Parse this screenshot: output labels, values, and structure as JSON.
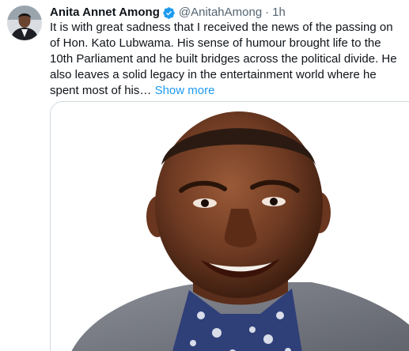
{
  "author": {
    "display_name": "Anita Annet Among",
    "handle": "@AnitahAmong",
    "separator": "·",
    "time": "1h",
    "verified_icon": "verified-badge-icon",
    "verified_color": "#1d9bf0"
  },
  "post": {
    "text": "It is with great sadness that I received the news of the passing on of  Hon. Kato Lubwama. His sense of humour brought life to the 10th Parliament and he built bridges across the political divide. He also leaves a solid legacy in the entertainment world where he spent most of his…",
    "show_more_label": "Show more",
    "link_color": "#1d9bf0"
  },
  "media": {
    "kind": "portrait-photo"
  }
}
